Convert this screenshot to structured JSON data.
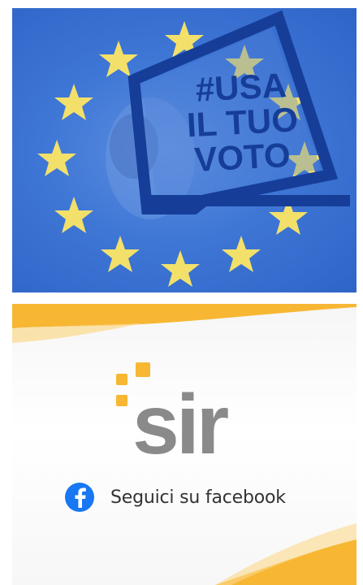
{
  "banner": {
    "headline_line1": "#USA",
    "headline_line2": "IL TUO",
    "headline_line3": "VOTO",
    "colors": {
      "sky": "#3f77d6",
      "star": "#f2e06a",
      "box": "#163e98"
    }
  },
  "promo": {
    "logo_text": "sir",
    "facebook_label": "Seguici su facebook",
    "colors": {
      "accent": "#f7b733",
      "logo_gray": "#8a8a8a",
      "facebook": "#1877f2"
    },
    "icons": [
      "facebook-icon",
      "sir-logo-squares"
    ]
  }
}
